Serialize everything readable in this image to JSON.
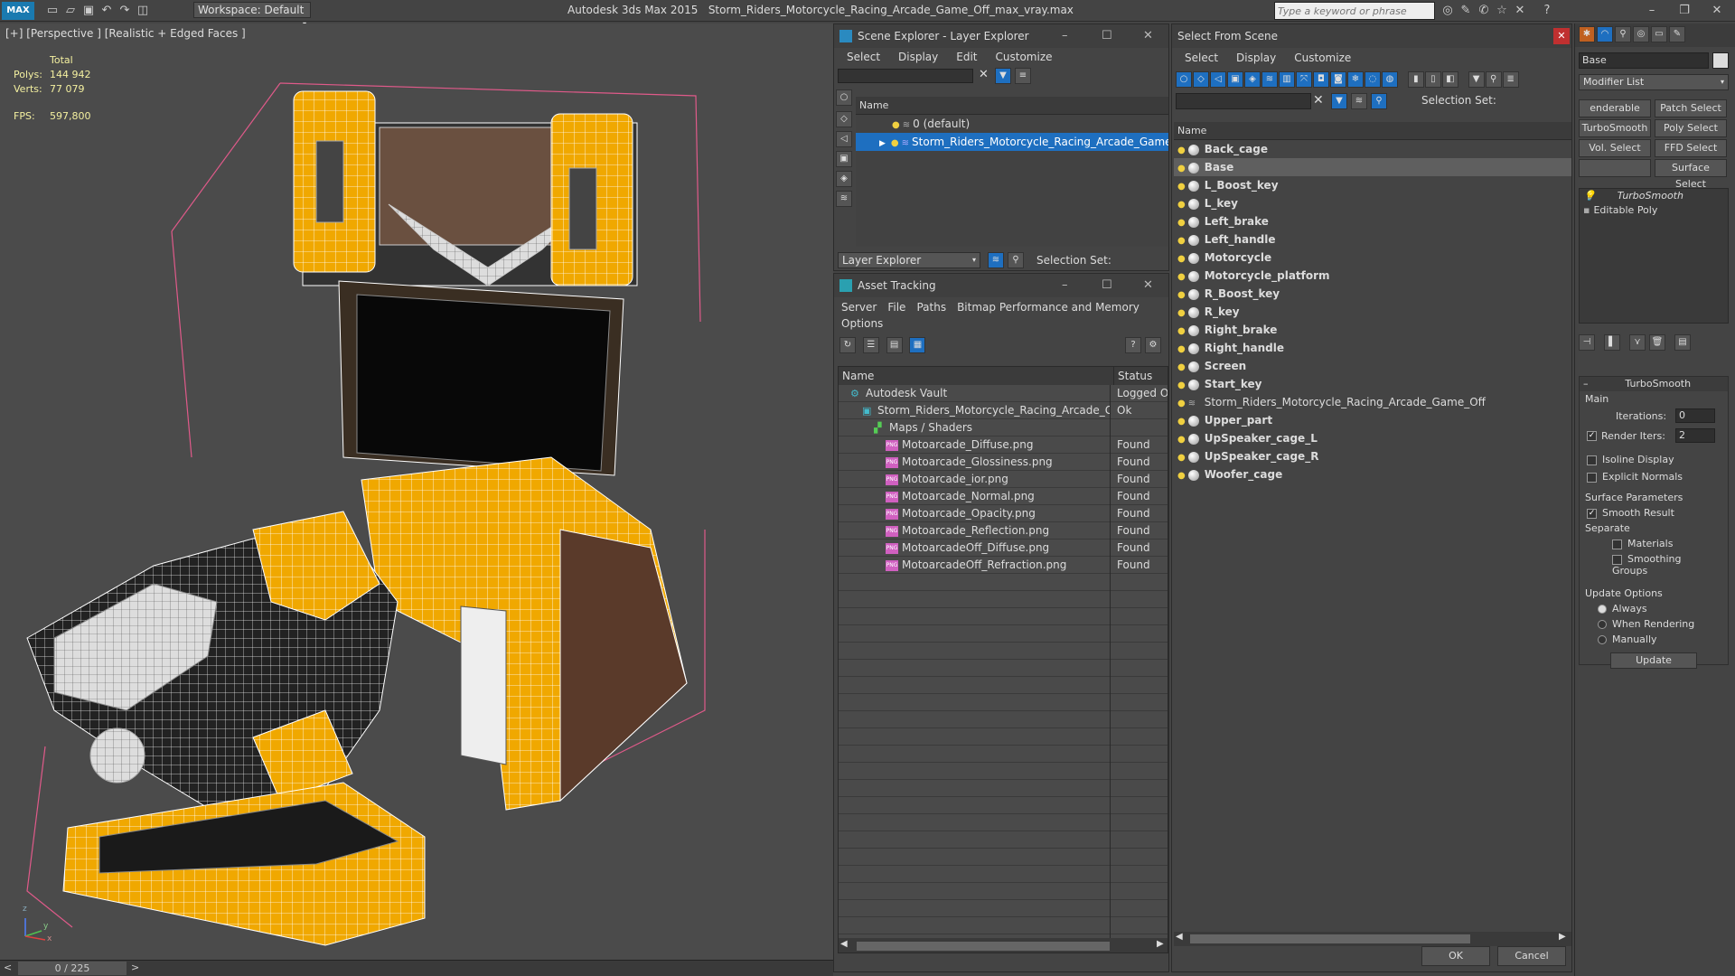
{
  "app": {
    "logo": "MAX",
    "workspace": "Workspace: Default",
    "title": "Autodesk 3ds Max  2015",
    "file": "Storm_Riders_Motorcycle_Racing_Arcade_Game_Off_max_vray.max",
    "search_placeholder": "Type a keyword or phrase"
  },
  "viewport": {
    "label": "[+] [Perspective ] [Realistic + Edged Faces ]",
    "stats": {
      "total_label": "Total",
      "polys_label": "Polys:",
      "polys": "144 942",
      "verts_label": "Verts:",
      "verts": "77 079",
      "fps_label": "FPS:",
      "fps": "597,800"
    },
    "frame": "0 / 225",
    "axis_z": "z",
    "axis_y": "y",
    "axis_x": "x"
  },
  "scene_explorer": {
    "title": "Scene Explorer - Layer Explorer",
    "menu": [
      "Select",
      "Display",
      "Edit",
      "Customize"
    ],
    "col_name": "Name",
    "rows": [
      "0 (default)",
      "Storm_Riders_Motorcycle_Racing_Arcade_Game_Off"
    ],
    "footer_label": "Layer Explorer",
    "selection_set": "Selection Set:"
  },
  "asset_tracking": {
    "title": "Asset Tracking",
    "menu": [
      "Server",
      "File",
      "Paths",
      "Bitmap Performance and Memory",
      "Options"
    ],
    "col_name": "Name",
    "col_status": "Status",
    "rows": [
      {
        "name": "Autodesk Vault",
        "status": "Logged Ou",
        "indent": 1,
        "kind": "vault"
      },
      {
        "name": "Storm_Riders_Motorcycle_Racing_Arcade_G...",
        "status": "Ok",
        "indent": 2,
        "kind": "max"
      },
      {
        "name": "Maps / Shaders",
        "status": "",
        "indent": 3,
        "kind": "folder"
      },
      {
        "name": "Motoarcade_Diffuse.png",
        "status": "Found",
        "indent": 4,
        "kind": "png"
      },
      {
        "name": "Motoarcade_Glossiness.png",
        "status": "Found",
        "indent": 4,
        "kind": "png"
      },
      {
        "name": "Motoarcade_ior.png",
        "status": "Found",
        "indent": 4,
        "kind": "png"
      },
      {
        "name": "Motoarcade_Normal.png",
        "status": "Found",
        "indent": 4,
        "kind": "png"
      },
      {
        "name": "Motoarcade_Opacity.png",
        "status": "Found",
        "indent": 4,
        "kind": "png"
      },
      {
        "name": "Motoarcade_Reflection.png",
        "status": "Found",
        "indent": 4,
        "kind": "png"
      },
      {
        "name": "MotoarcadeOff_Diffuse.png",
        "status": "Found",
        "indent": 4,
        "kind": "png"
      },
      {
        "name": "MotoarcadeOff_Refraction.png",
        "status": "Found",
        "indent": 4,
        "kind": "png"
      }
    ]
  },
  "select_from_scene": {
    "title": "Select From Scene",
    "menu": [
      "Select",
      "Display",
      "Customize"
    ],
    "selection_set": "Selection Set:",
    "col_name": "Name",
    "items": [
      "Back_cage",
      "Base",
      "L_Boost_key",
      "L_key",
      "Left_brake",
      "Left_handle",
      "Motorcycle",
      "Motorcycle_platform",
      "R_Boost_key",
      "R_key",
      "Right_brake",
      "Right_handle",
      "Screen",
      "Start_key",
      "Storm_Riders_Motorcycle_Racing_Arcade_Game_Off",
      "Upper_part",
      "UpSpeaker_cage_L",
      "UpSpeaker_cage_R",
      "Woofer_cage"
    ],
    "selected": "Base",
    "ok": "OK",
    "cancel": "Cancel"
  },
  "modify_panel": {
    "object_name": "Base",
    "modifier_list": "Modifier List",
    "buttons": [
      "enderable Spli",
      "Patch Select",
      "TurboSmooth",
      "Poly Select",
      "Vol. Select",
      "FFD Select",
      "",
      "Surface Select"
    ],
    "stack": [
      "TurboSmooth",
      "Editable Poly"
    ],
    "rollout": {
      "title": "TurboSmooth",
      "main": "Main",
      "iterations_label": "Iterations:",
      "iterations": "0",
      "render_iters_label": "Render Iters:",
      "render_iters": "2",
      "isoline": "Isoline Display",
      "explicit": "Explicit Normals",
      "surface": "Surface Parameters",
      "smooth_result": "Smooth Result",
      "separate": "Separate",
      "materials": "Materials",
      "smoothing_groups": "Smoothing Groups",
      "update_options": "Update Options",
      "always": "Always",
      "when_rendering": "When Rendering",
      "manually": "Manually",
      "update": "Update"
    }
  },
  "colors": {
    "accent": "#1e6fc0",
    "wire": "#f0a800"
  }
}
